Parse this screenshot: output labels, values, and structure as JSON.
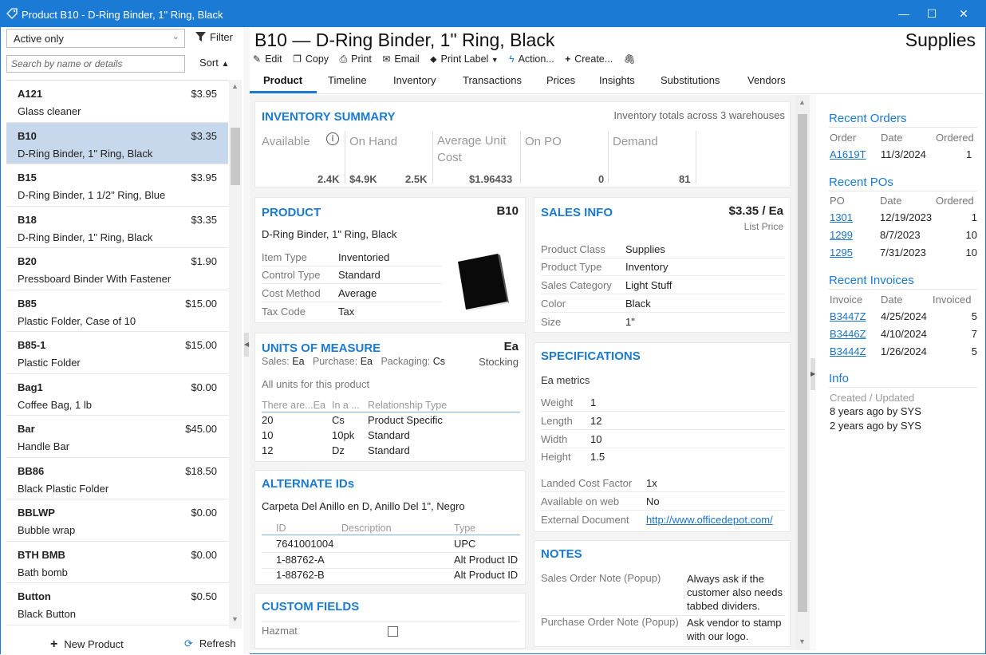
{
  "window": {
    "title": "Product B10 - D-Ring Binder, 1\" Ring, Black",
    "minimize": "—",
    "maximize": "☐",
    "close": "✕"
  },
  "left": {
    "status_filter": "Active only",
    "filter_label": "Filter",
    "search_placeholder": "Search by name or details",
    "sort_label": "Sort",
    "items": [
      {
        "code": "A121",
        "price": "$3.95",
        "desc": "Glass cleaner"
      },
      {
        "code": "B10",
        "price": "$3.35",
        "desc": "D-Ring Binder, 1\" Ring, Black"
      },
      {
        "code": "B15",
        "price": "$3.95",
        "desc": "D-Ring Binder, 1 1/2\" Ring, Blue"
      },
      {
        "code": "B18",
        "price": "$3.35",
        "desc": "D-Ring Binder, 1\" Ring, Black"
      },
      {
        "code": "B20",
        "price": "$1.90",
        "desc": "Pressboard Binder With Fastener"
      },
      {
        "code": "B85",
        "price": "$15.00",
        "desc": "Plastic Folder, Case of 10"
      },
      {
        "code": "B85-1",
        "price": "$15.00",
        "desc": "Plastic Folder"
      },
      {
        "code": "Bag1",
        "price": "$0.00",
        "desc": "Coffee Bag, 1 lb"
      },
      {
        "code": "Bar",
        "price": "$45.00",
        "desc": "Handle Bar"
      },
      {
        "code": "BB86",
        "price": "$18.50",
        "desc": "Black Plastic Folder"
      },
      {
        "code": "BBLWP",
        "price": "$0.00",
        "desc": "Bubble wrap"
      },
      {
        "code": "BTH BMB",
        "price": "$0.00",
        "desc": "Bath bomb"
      },
      {
        "code": "Button",
        "price": "$0.50",
        "desc": "Black Button"
      }
    ],
    "new_product": "New Product",
    "refresh": "Refresh"
  },
  "header": {
    "title": "B10 — D-Ring Binder, 1\" Ring, Black",
    "category": "Supplies",
    "toolbar": {
      "edit": "Edit",
      "copy": "Copy",
      "print": "Print",
      "email": "Email",
      "print_label": "Print Label",
      "action": "Action...",
      "create": "Create..."
    },
    "tabs": [
      "Product",
      "Timeline",
      "Inventory",
      "Transactions",
      "Prices",
      "Insights",
      "Substitutions",
      "Vendors"
    ]
  },
  "inventory_summary": {
    "title": "INVENTORY SUMMARY",
    "note": "Inventory totals across 3 warehouses",
    "cols": [
      {
        "label": "Available",
        "value": "2.4K"
      },
      {
        "label": "On Hand",
        "value": "$4.9K",
        "value2": "2.5K"
      },
      {
        "label": "Average Unit Cost",
        "value": "$1.96433"
      },
      {
        "label": "On PO",
        "value": "0"
      },
      {
        "label": "Demand",
        "value": "81"
      }
    ]
  },
  "product": {
    "title": "PRODUCT",
    "code": "B10",
    "desc": "D-Ring Binder, 1\" Ring, Black",
    "rows": [
      {
        "label": "Item Type",
        "value": "Inventoried"
      },
      {
        "label": "Control Type",
        "value": "Standard"
      },
      {
        "label": "Cost Method",
        "value": "Average"
      },
      {
        "label": "Tax Code",
        "value": "Tax"
      }
    ]
  },
  "sales_info": {
    "title": "SALES INFO",
    "price": "$3.35 / Ea",
    "price_caption": "List Price",
    "rows": [
      {
        "label": "Product Class",
        "value": "Supplies"
      },
      {
        "label": "Product Type",
        "value": "Inventory"
      },
      {
        "label": "Sales Category",
        "value": "Light Stuff"
      },
      {
        "label": "Color",
        "value": "Black"
      },
      {
        "label": "Size",
        "value": "1\""
      }
    ]
  },
  "uom": {
    "title": "UNITS OF MEASURE",
    "unit": "Ea",
    "sales_label": "Sales:",
    "sales": "Ea",
    "purchase_label": "Purchase:",
    "purchase": "Ea",
    "packaging_label": "Packaging:",
    "packaging": "Cs",
    "stocking": "Stocking",
    "subtitle": "All units for this product",
    "headers": [
      "There are...Ea",
      "In a ...",
      "Relationship Type"
    ],
    "rows": [
      [
        "20",
        "Cs",
        "Product Specific"
      ],
      [
        "10",
        "10pk",
        "Standard"
      ],
      [
        "12",
        "Dz",
        "Standard"
      ]
    ]
  },
  "specs": {
    "title": "SPECIFICATIONS",
    "metrics": "Ea metrics",
    "rows": [
      {
        "label": "Weight",
        "value": "1"
      },
      {
        "label": "Length",
        "value": "12"
      },
      {
        "label": "Width",
        "value": "10"
      },
      {
        "label": "Height",
        "value": "1.5"
      }
    ],
    "rows2": [
      {
        "label": "Landed Cost Factor",
        "value": "1x"
      },
      {
        "label": "Available on web",
        "value": "No"
      },
      {
        "label": "External Document",
        "value": "http://www.officedepot.com/"
      }
    ]
  },
  "alt_ids": {
    "title": "ALTERNATE IDs",
    "desc": "Carpeta Del Anillo en D, Anillo Del 1\", Negro",
    "headers": [
      "ID",
      "Description",
      "Type"
    ],
    "rows": [
      [
        "7641001004",
        "",
        "UPC"
      ],
      [
        "1-88762-A",
        "",
        "Alt Product ID"
      ],
      [
        "1-88762-B",
        "",
        "Alt Product ID"
      ]
    ]
  },
  "notes": {
    "title": "NOTES",
    "rows": [
      {
        "label": "Sales Order Note (Popup)",
        "value": "Always ask if the customer also needs tabbed dividers."
      },
      {
        "label": "Purchase Order Note (Popup)",
        "value": "Ask vendor to stamp with our logo."
      }
    ]
  },
  "custom_fields": {
    "title": "CUSTOM FIELDS",
    "hazmat": "Hazmat"
  },
  "right": {
    "orders": {
      "title": "Recent Orders",
      "headers": [
        "Order",
        "Date",
        "Ordered"
      ],
      "rows": [
        [
          "A1619T",
          "11/3/2024",
          "1"
        ]
      ]
    },
    "pos": {
      "title": "Recent POs",
      "headers": [
        "PO",
        "Date",
        "Ordered"
      ],
      "rows": [
        [
          "1301",
          "12/19/2023",
          "1"
        ],
        [
          "1299",
          "8/7/2023",
          "10"
        ],
        [
          "1295",
          "7/31/2023",
          "10"
        ]
      ]
    },
    "invoices": {
      "title": "Recent Invoices",
      "headers": [
        "Invoice",
        "Date",
        "Invoiced"
      ],
      "rows": [
        [
          "B3447Z",
          "4/25/2024",
          "5"
        ],
        [
          "B3446Z",
          "4/10/2024",
          "7"
        ],
        [
          "B3444Z",
          "1/26/2024",
          "5"
        ]
      ]
    },
    "info": {
      "title": "Info",
      "label": "Created / Updated",
      "created": "8 years ago by SYS",
      "updated": "2 years ago by SYS"
    }
  }
}
